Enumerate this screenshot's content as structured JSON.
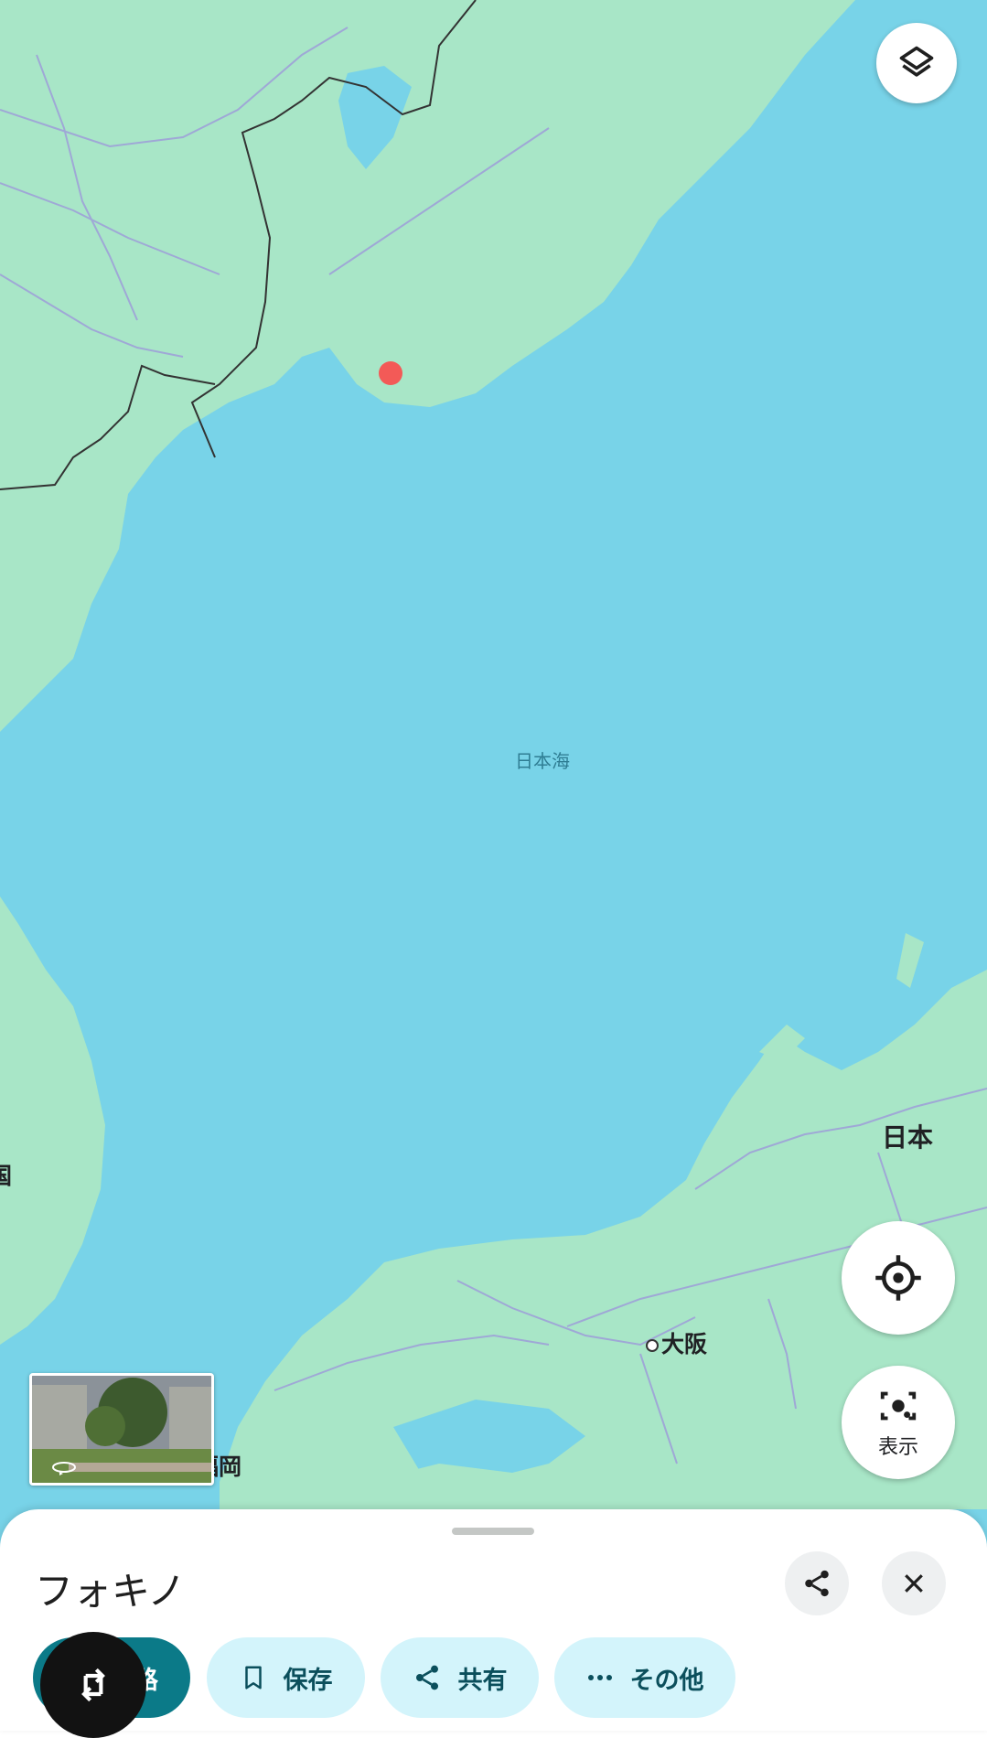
{
  "map": {
    "sea_label": "日本海",
    "country_label": "日本",
    "city_osaka": "大阪",
    "city_fukuoka": "福岡",
    "edge_label": "国",
    "pin_color": "#f35a57"
  },
  "controls": {
    "layers_icon": "layers-icon",
    "locate_icon": "my-location-icon",
    "lens_label": "表示"
  },
  "place": {
    "title": "フォキノ"
  },
  "actions": {
    "route_label": "経路",
    "save_label": "保存",
    "share_label": "共有",
    "more_label": "その他"
  },
  "colors": {
    "sea": "#78d3e8",
    "land": "#a8e6c7",
    "accent": "#0b7a88",
    "chip_bg": "#d3f4fb"
  }
}
